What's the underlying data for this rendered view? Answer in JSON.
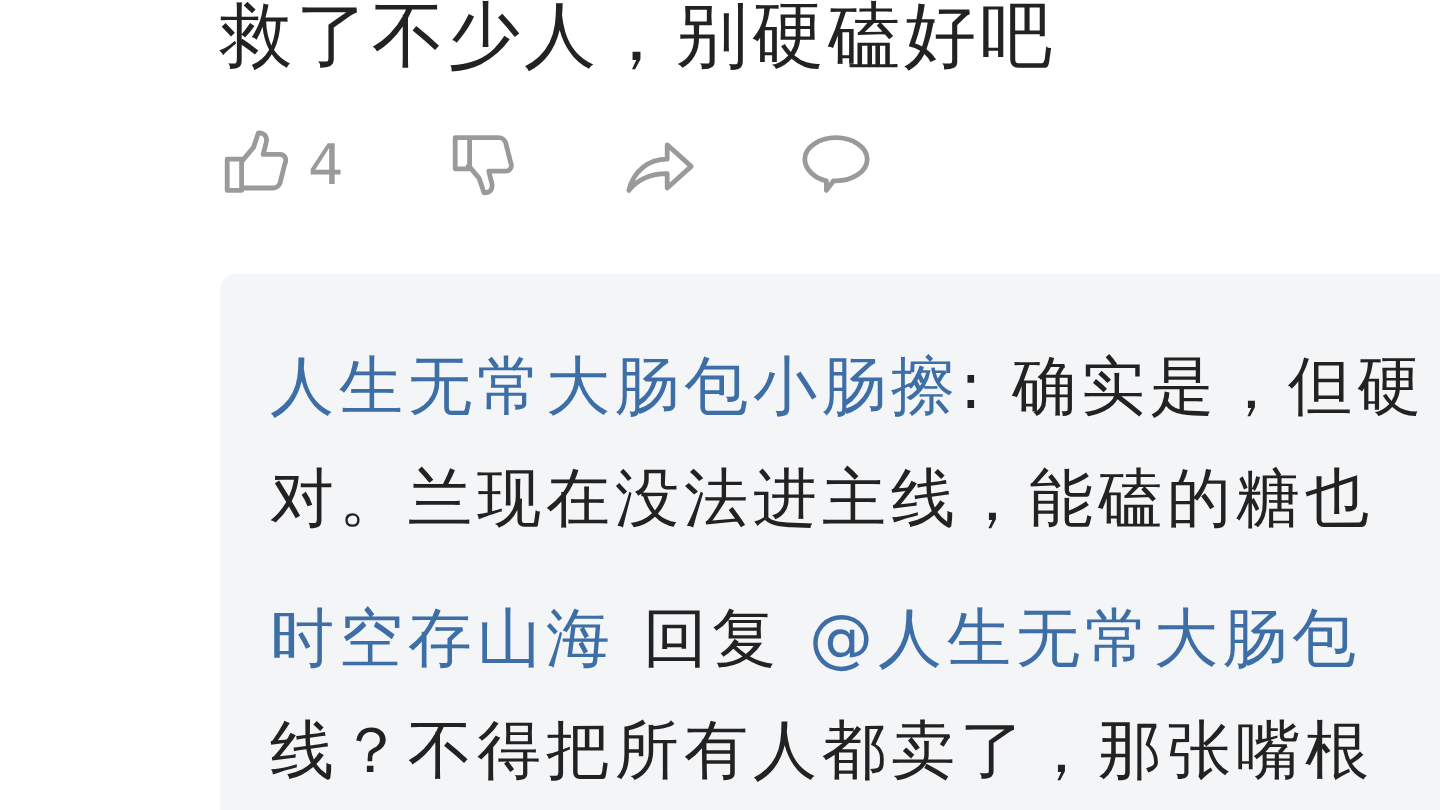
{
  "comment": {
    "text": "救了不少人，别硬磕好吧",
    "actions": [
      {
        "kind": "like",
        "count": "4"
      },
      {
        "kind": "dislike"
      },
      {
        "kind": "share"
      },
      {
        "kind": "reply"
      }
    ]
  },
  "replies": [
    {
      "author": "人生无常大肠包小肠擦",
      "lines": [
        ": 确实是，但硬",
        "对。兰现在没法进主线，能磕的糖也"
      ]
    },
    {
      "author": "时空存山海",
      "reply_word": "回复",
      "reply_to": "@人生无常大肠包",
      "lines": [
        "线？不得把所有人都卖了，那张嘴根"
      ]
    }
  ]
}
